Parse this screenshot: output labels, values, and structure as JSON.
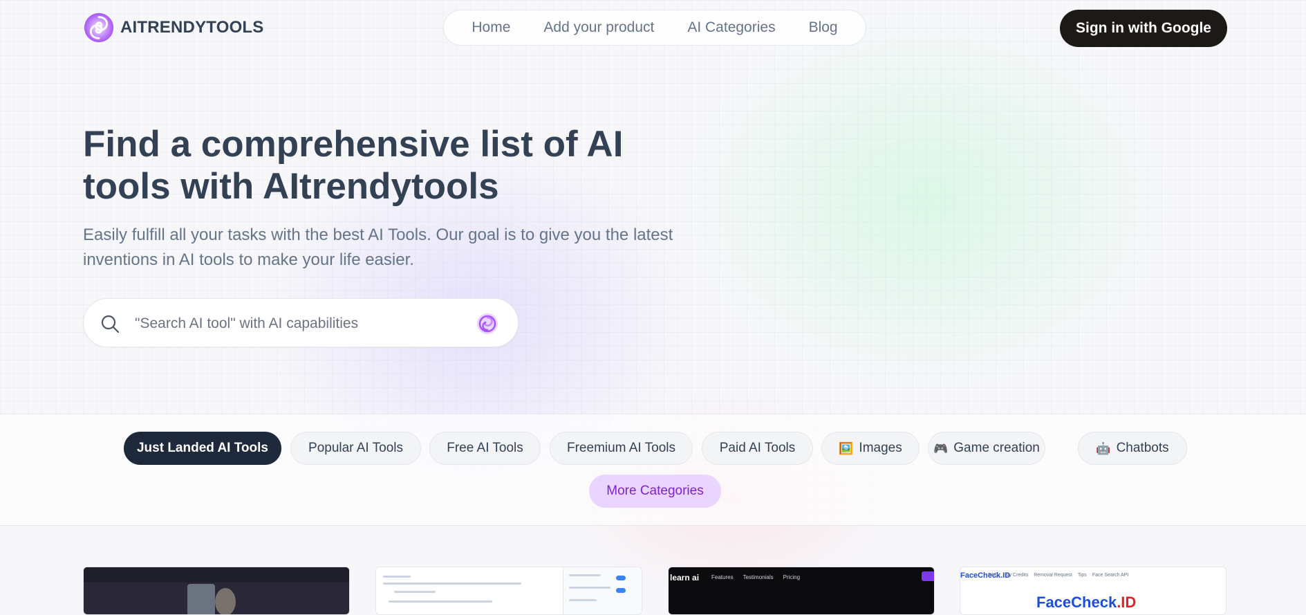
{
  "brand": {
    "name": "AITRENDYTOOLS"
  },
  "nav": {
    "items": [
      "Home",
      "Add your product",
      "AI Categories",
      "Blog"
    ]
  },
  "header": {
    "signin_label": "Sign in with Google"
  },
  "hero": {
    "title": "Find a comprehensive list of AI tools with AItrendytools",
    "subtitle": "Easily fulfill all your tasks with the best AI Tools. Our goal is to give you the latest inventions in AI tools to make your life easier."
  },
  "search": {
    "placeholder": "\"Search AI tool\" with AI capabilities",
    "value": ""
  },
  "categories": {
    "pills": [
      {
        "label": "Just Landed AI Tools",
        "icon": "",
        "active": true
      },
      {
        "label": "Popular AI Tools",
        "icon": ""
      },
      {
        "label": "Free AI Tools",
        "icon": ""
      },
      {
        "label": "Freemium AI Tools",
        "icon": ""
      },
      {
        "label": "Paid AI Tools",
        "icon": ""
      },
      {
        "label": "Images",
        "icon": "🖼️"
      },
      {
        "label": "Game creation",
        "icon": "🎮"
      },
      {
        "label": "Chatbots",
        "icon": "🤖"
      }
    ],
    "more_label": "More Categories"
  },
  "cards": [
    {
      "thumb_text": ""
    },
    {
      "thumb_text": ""
    },
    {
      "brand": "learn ai",
      "links": [
        "Features",
        "Testimonials",
        "Pricing"
      ]
    },
    {
      "brand": "FaceCheck.ID",
      "nav": [
        "FAQ",
        "Buy Credits",
        "Removal Request",
        "Tips",
        "Face Search API"
      ],
      "title_a": "FaceCheck",
      "title_b": ".ID"
    }
  ],
  "colors": {
    "accent": "#a855f7",
    "dark": "#1c1917",
    "active_pill": "#1e293b",
    "more_pill_bg": "#e9d5ff",
    "more_pill_text": "#7e22ce"
  }
}
